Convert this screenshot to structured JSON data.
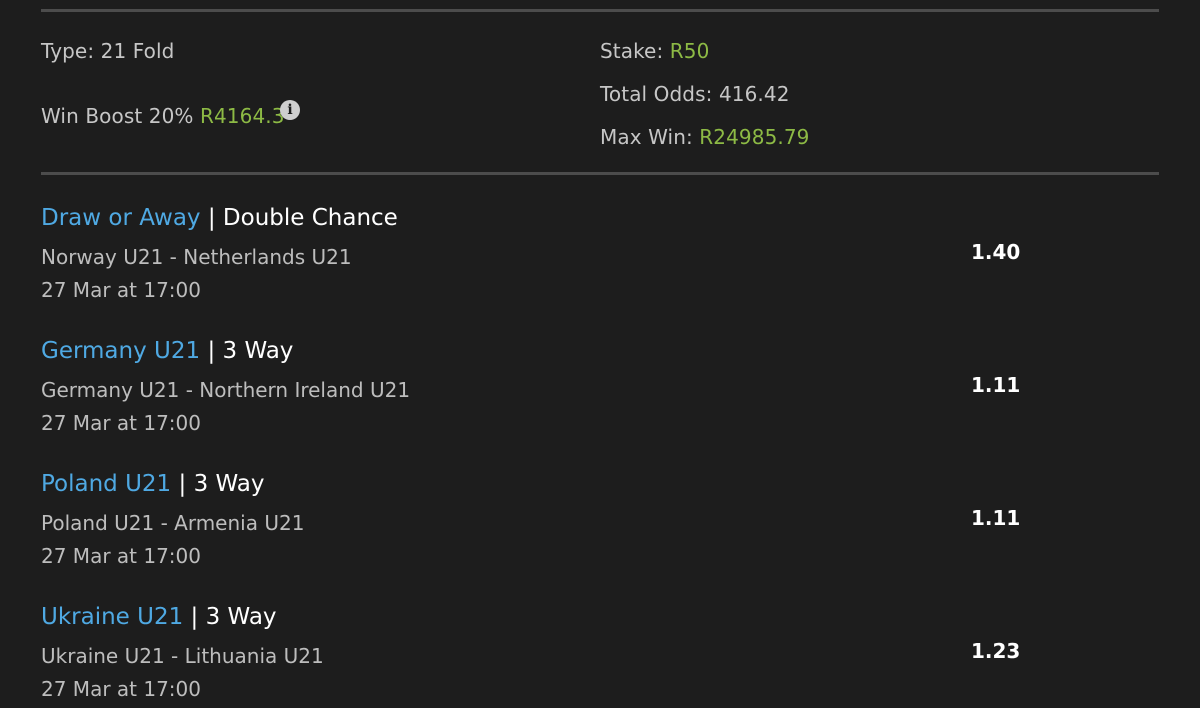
{
  "summary": {
    "type_label": "Type: 21 Fold",
    "win_boost_label": "Win Boost 20%",
    "win_boost_value": "R4164.3",
    "stake_label": "Stake:",
    "stake_value": "R50",
    "total_odds_label": "Total Odds:",
    "total_odds_value": "416.42",
    "max_win_label": "Max Win:",
    "max_win_value": "R24985.79",
    "info_icon": "info-icon"
  },
  "selections": [
    {
      "pick": "Draw or Away",
      "separator": "|",
      "market": "Double Chance",
      "match": "Norway U21 - Netherlands U21",
      "time": "27 Mar at 17:00",
      "odds": "1.40"
    },
    {
      "pick": "Germany U21",
      "separator": "|",
      "market": "3 Way",
      "match": "Germany U21 - Northern Ireland U21",
      "time": "27 Mar at 17:00",
      "odds": "1.11"
    },
    {
      "pick": "Poland U21",
      "separator": "|",
      "market": "3 Way",
      "match": "Poland U21 - Armenia U21",
      "time": "27 Mar at 17:00",
      "odds": "1.11"
    },
    {
      "pick": "Ukraine U21",
      "separator": "|",
      "market": "3 Way",
      "match": "Ukraine U21 - Lithuania U21",
      "time": "27 Mar at 17:00",
      "odds": "1.23"
    }
  ],
  "colors": {
    "background": "#1d1d1d",
    "pick_blue": "#4fa9e3",
    "money_green": "#8dba45",
    "divider": "#4c4c4c"
  }
}
